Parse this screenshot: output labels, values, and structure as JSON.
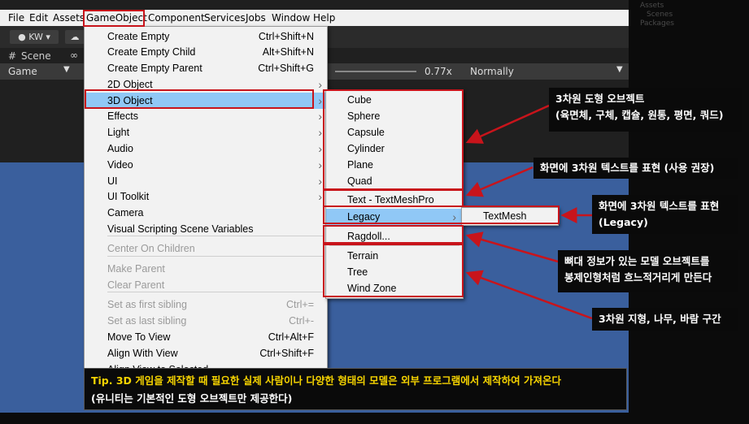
{
  "menubar": [
    "File",
    "Edit",
    "Assets",
    "GameObject",
    "Component",
    "Services",
    "Jobs",
    "Window",
    "Help"
  ],
  "toolbar": {
    "account": "KW"
  },
  "tabs": {
    "scene": "Scene"
  },
  "gamebar": {
    "game": "Game",
    "zoom": "0.77x",
    "mode": "Normally"
  },
  "right_panel": [
    "Assets",
    "Scenes",
    "Packages"
  ],
  "main_menu": [
    {
      "label": "Create Empty",
      "shortcut": "Ctrl+Shift+N"
    },
    {
      "label": "Create Empty Child",
      "shortcut": "Alt+Shift+N"
    },
    {
      "label": "Create Empty Parent",
      "shortcut": "Ctrl+Shift+G"
    },
    {
      "label": "2D Object",
      "submenu": true
    },
    {
      "label": "3D Object",
      "submenu": true,
      "selected": true
    },
    {
      "label": "Effects",
      "submenu": true
    },
    {
      "label": "Light",
      "submenu": true
    },
    {
      "label": "Audio",
      "submenu": true
    },
    {
      "label": "Video",
      "submenu": true
    },
    {
      "label": "UI",
      "submenu": true
    },
    {
      "label": "UI Toolkit",
      "submenu": true
    },
    {
      "label": "Camera"
    },
    {
      "label": "Visual Scripting Scene Variables"
    },
    {
      "label": "Center On Children",
      "disabled": true
    },
    {
      "label": "Make Parent",
      "disabled": true
    },
    {
      "label": "Clear Parent",
      "disabled": true
    },
    {
      "label": "Set as first sibling",
      "shortcut": "Ctrl+=",
      "disabled": true
    },
    {
      "label": "Set as last sibling",
      "shortcut": "Ctrl+-",
      "disabled": true
    },
    {
      "label": "Move To View",
      "shortcut": "Ctrl+Alt+F"
    },
    {
      "label": "Align With View",
      "shortcut": "Ctrl+Shift+F"
    },
    {
      "label": "Align View to Selected"
    }
  ],
  "sub_menu": [
    {
      "label": "Cube"
    },
    {
      "label": "Sphere"
    },
    {
      "label": "Capsule"
    },
    {
      "label": "Cylinder"
    },
    {
      "label": "Plane"
    },
    {
      "label": "Quad"
    },
    {
      "label": "Text - TextMeshPro"
    },
    {
      "label": "Legacy",
      "submenu": true,
      "selected": true
    },
    {
      "label": "Ragdoll..."
    },
    {
      "label": "Terrain"
    },
    {
      "label": "Tree"
    },
    {
      "label": "Wind Zone"
    }
  ],
  "legacy_menu": [
    {
      "label": "TextMesh"
    }
  ],
  "callouts": {
    "c1_line1": "3차원 도형 오브젝트",
    "c1_line2": "(육면체, 구체, 캡슐, 원통, 평면, 쿼드)",
    "c2": "화면에 3차원 텍스트를 표현 (사용 권장)",
    "c3_line1": "화면에 3차원 텍스트를 표현",
    "c3_line2": "(Legacy)",
    "c4_line1": "뼈대 정보가 있는 모델 오브젝트를",
    "c4_line2": "봉제인형처럼 흐느적거리게 만든다",
    "c5": "3차원 지형, 나무, 바람 구간"
  },
  "tip": {
    "line1": "Tip. 3D 게임을 제작할 때 필요한 실제 사람이나 다양한 형태의 모델은 외부 프로그램에서 제작하여 가져온다",
    "line2": "(유니티는 기본적인 도형 오브젝트만 제공한다)"
  },
  "colors": {
    "highlight": "#c8141b",
    "selection": "#90c8f6",
    "scene_blue": "#3a5f9d",
    "tip_text": "#f5d300"
  }
}
